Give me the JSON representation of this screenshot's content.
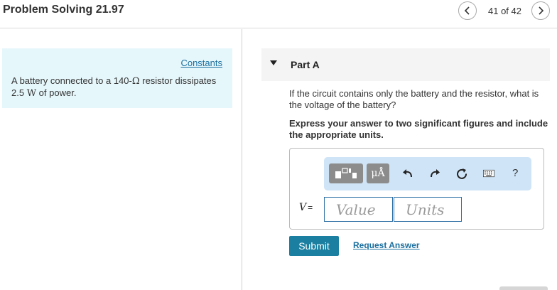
{
  "header": {
    "title": "Problem Solving 21.97",
    "counter": "41 of 42",
    "prev_icon": "chevron-left-icon",
    "next_icon": "chevron-right-icon"
  },
  "left_panel": {
    "constants_link": "Constants",
    "problem_pre": "A battery connected to a 140-",
    "problem_ohm": "Ω",
    "problem_mid": " resistor dissipates 2.5 ",
    "problem_watt": "W",
    "problem_post": " of power."
  },
  "part": {
    "label": "Part A",
    "question": "If the circuit contains only the battery and the resistor, what is the voltage of the battery?",
    "instruction": "Express your answer to two significant figures and include the appropriate units."
  },
  "toolbar": {
    "units_label": "μÅ",
    "icons": [
      "templates-icon",
      "units-icon",
      "undo-icon",
      "redo-icon",
      "reset-icon",
      "keyboard-icon",
      "help-icon"
    ],
    "help_label": "?"
  },
  "answer": {
    "variable": "V",
    "equals": "=",
    "value_placeholder": "Value",
    "units_placeholder": "Units"
  },
  "actions": {
    "submit_label": "Submit",
    "request_label": "Request Answer"
  },
  "colors": {
    "accent": "#1a7fa0",
    "link": "#1b6f9f",
    "panel_bg": "#e6f7fb",
    "toolbar_bg": "#cfe4f7"
  }
}
